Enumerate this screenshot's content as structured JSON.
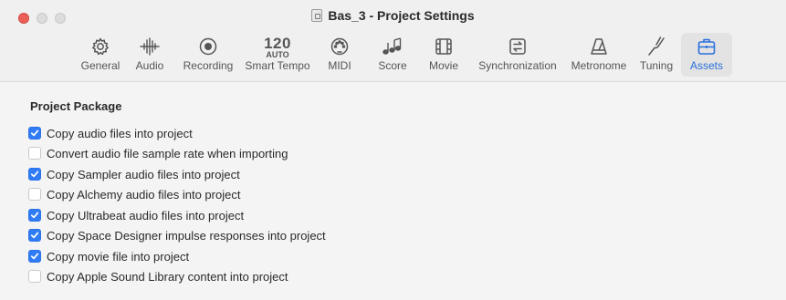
{
  "window": {
    "title": "Bas_3 - Project Settings"
  },
  "tabs": [
    {
      "label": "General",
      "icon": "gear-icon"
    },
    {
      "label": "Audio",
      "icon": "waveform-icon"
    },
    {
      "label": "Recording",
      "icon": "record-icon"
    },
    {
      "label": "Smart Tempo",
      "icon": "tempo-icon",
      "tempo_value": "120",
      "tempo_mode": "AUTO"
    },
    {
      "label": "MIDI",
      "icon": "midi-icon"
    },
    {
      "label": "Score",
      "icon": "notes-icon"
    },
    {
      "label": "Movie",
      "icon": "film-icon"
    },
    {
      "label": "Synchronization",
      "icon": "sync-icon"
    },
    {
      "label": "Metronome",
      "icon": "metronome-icon"
    },
    {
      "label": "Tuning",
      "icon": "tuning-fork-icon"
    },
    {
      "label": "Assets",
      "icon": "briefcase-icon",
      "active": true
    }
  ],
  "section": {
    "title": "Project Package"
  },
  "options": [
    {
      "label": "Copy audio files into project",
      "checked": true
    },
    {
      "label": "Convert audio file sample rate when importing",
      "checked": false
    },
    {
      "label": "Copy Sampler audio files into project",
      "checked": true
    },
    {
      "label": "Copy Alchemy audio files into project",
      "checked": false
    },
    {
      "label": "Copy Ultrabeat audio files into project",
      "checked": true
    },
    {
      "label": "Copy Space Designer impulse responses into project",
      "checked": true
    },
    {
      "label": "Copy movie file into project",
      "checked": true
    },
    {
      "label": "Copy Apple Sound Library content into project",
      "checked": false
    }
  ],
  "colors": {
    "accent": "#2f7cf6",
    "close_button": "#ec5f57"
  }
}
